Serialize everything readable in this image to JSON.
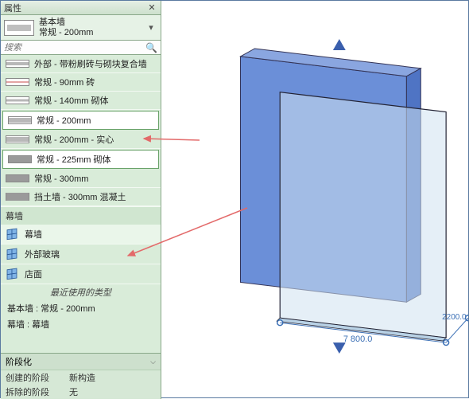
{
  "panel": {
    "title": "属性",
    "current": {
      "line1": "基本墙",
      "line2": "常规 - 200mm"
    },
    "search_placeholder": "搜索"
  },
  "type_list": [
    {
      "label": "外部 - 带粉刷砖与砌块复合墙",
      "swatch": "compound"
    },
    {
      "label": "常规 - 90mm 砖",
      "swatch": "thin"
    },
    {
      "label": "常规 - 140mm 砌体",
      "swatch": "med"
    },
    {
      "label": "常规 - 200mm",
      "swatch": "wide",
      "selected": true
    },
    {
      "label": "常规 - 200mm - 实心",
      "swatch": "wide"
    },
    {
      "label": "常规 - 225mm 砌体",
      "swatch": "solid",
      "selected2": true
    },
    {
      "label": "常规 - 300mm",
      "swatch": "solid"
    },
    {
      "label": "挡土墙 - 300mm 混凝土",
      "swatch": "thick"
    }
  ],
  "curtain_category": "幕墙",
  "curtain_list": [
    {
      "label": "幕墙",
      "highlight": true
    },
    {
      "label": "外部玻璃"
    },
    {
      "label": "店面"
    }
  ],
  "recent": {
    "header": "最近使用的类型",
    "items": [
      "基本墙 : 常规 - 200mm",
      "幕墙 : 幕墙"
    ]
  },
  "phase": {
    "title": "阶段化",
    "rows": [
      {
        "k": "创建的阶段",
        "v": "新构造"
      },
      {
        "k": "拆除的阶段",
        "v": "无"
      }
    ]
  },
  "dims": {
    "d1": "7 800.0",
    "d2": "2200.0"
  }
}
